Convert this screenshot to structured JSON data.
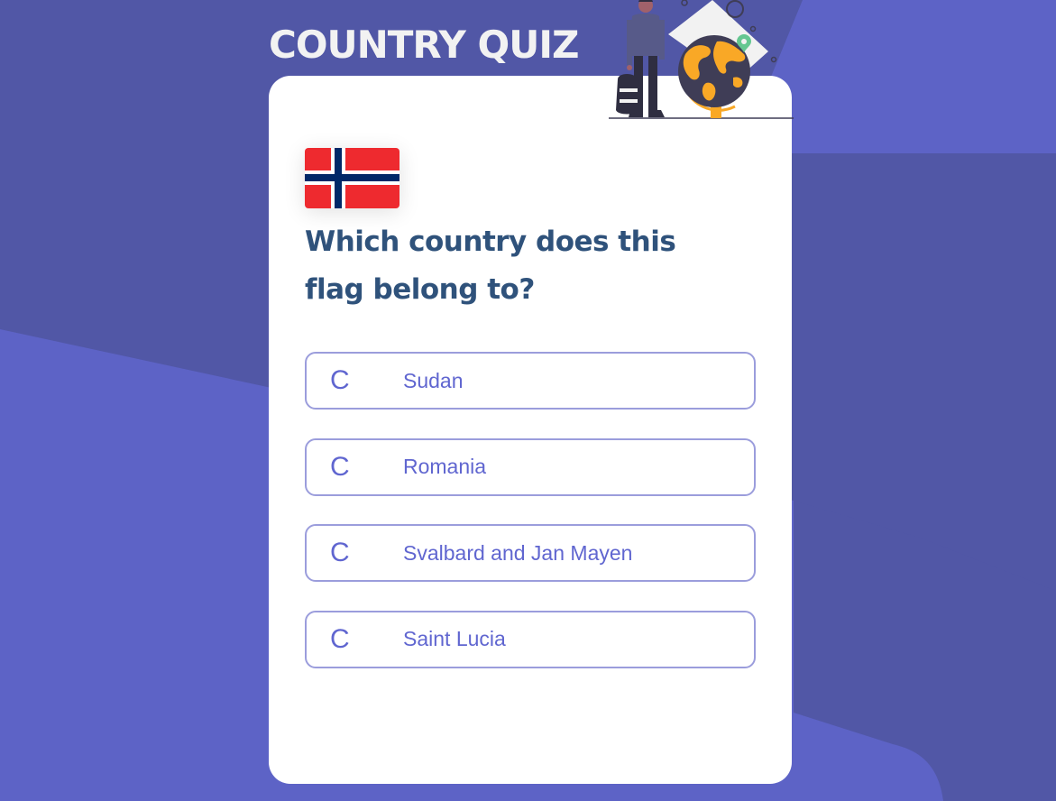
{
  "app": {
    "title": "COUNTRY QUIZ"
  },
  "question": {
    "flag_icon": "norway-flag-icon",
    "text": "Which country does this flag belong to?"
  },
  "options": [
    {
      "letter": "C",
      "text": "Sudan"
    },
    {
      "letter": "C",
      "text": "Romania"
    },
    {
      "letter": "C",
      "text": "Svalbard and Jan Mayen"
    },
    {
      "letter": "C",
      "text": "Saint Lucia"
    }
  ],
  "colors": {
    "background": "#5d63c6",
    "background_dark": "#5157a6",
    "card": "#ffffff",
    "question_text": "#2f527b",
    "option_text": "#6066d0",
    "option_border": "#9b9ddc",
    "flag_red": "#ee2a2f",
    "flag_blue": "#002868",
    "globe_orange": "#f9a826"
  }
}
